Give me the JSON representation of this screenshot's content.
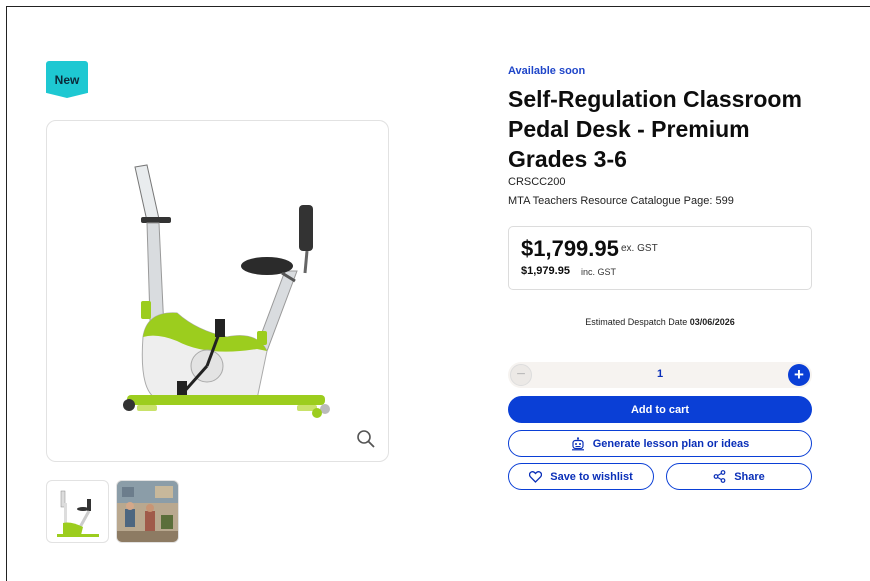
{
  "badge": {
    "label": "New"
  },
  "product": {
    "availability": "Available soon",
    "title": "Self-Regulation Classroom Pedal Desk - Premium Grades 3-6",
    "sku": "CRSCC200",
    "catalogue": "MTA Teachers Resource Catalogue Page: 599"
  },
  "price": {
    "ex_gst": "$1,799.95",
    "ex_gst_label": "ex. GST",
    "inc_gst": "$1,979.95",
    "inc_gst_label": "inc. GST"
  },
  "despatch": {
    "label": "Estimated Despatch Date",
    "date": "03/06/2026"
  },
  "quantity": {
    "value": "1",
    "minus": "−",
    "plus": "+"
  },
  "actions": {
    "add_to_cart": "Add to cart",
    "generate": "Generate lesson plan or ideas",
    "wishlist": "Save to wishlist",
    "share": "Share"
  },
  "icons": [
    "zoom-icon",
    "robot-icon",
    "heart-icon",
    "share-icon",
    "minus-icon",
    "plus-icon"
  ],
  "colors": {
    "accent": "#0a3fd6",
    "badge": "#1ec8d2",
    "bike_green": "#9ccd1e"
  }
}
